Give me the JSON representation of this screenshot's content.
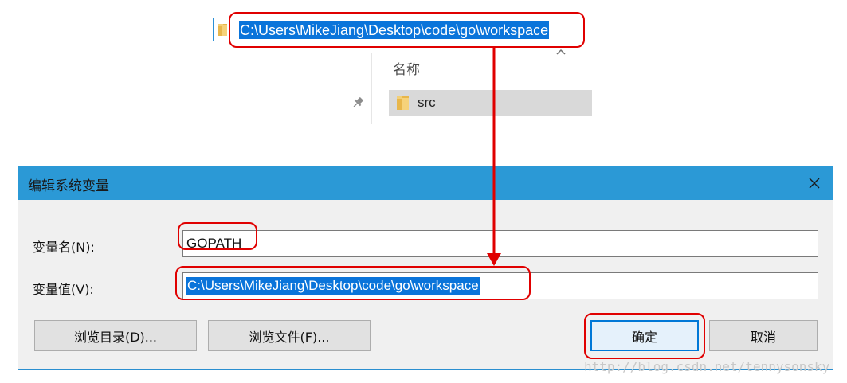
{
  "explorer": {
    "address_path": "C:\\Users\\MikeJiang\\Desktop\\code\\go\\workspace",
    "column_header_name": "名称",
    "file_items": [
      {
        "name": "src",
        "icon": "folder-icon"
      }
    ],
    "icons": {
      "address": "folder-icon",
      "sort": "chevron-up-icon",
      "pin": "pin-icon"
    }
  },
  "dialog": {
    "title": "编辑系统变量",
    "close_icon": "close-icon",
    "variable_name_label": "变量名(N):",
    "variable_name_value": "GOPATH",
    "variable_value_label": "变量值(V):",
    "variable_value_value": "C:\\Users\\MikeJiang\\Desktop\\code\\go\\workspace",
    "buttons": {
      "browse_directory": "浏览目录(D)...",
      "browse_file": "浏览文件(F)...",
      "ok": "确定",
      "cancel": "取消"
    }
  },
  "watermark": "http://blog.csdn.net/tennysonsky",
  "colors": {
    "titlebar": "#2b99d6",
    "selection": "#0a74da",
    "annotation": "#e00000",
    "dialog_bg": "#f0f0f0"
  }
}
